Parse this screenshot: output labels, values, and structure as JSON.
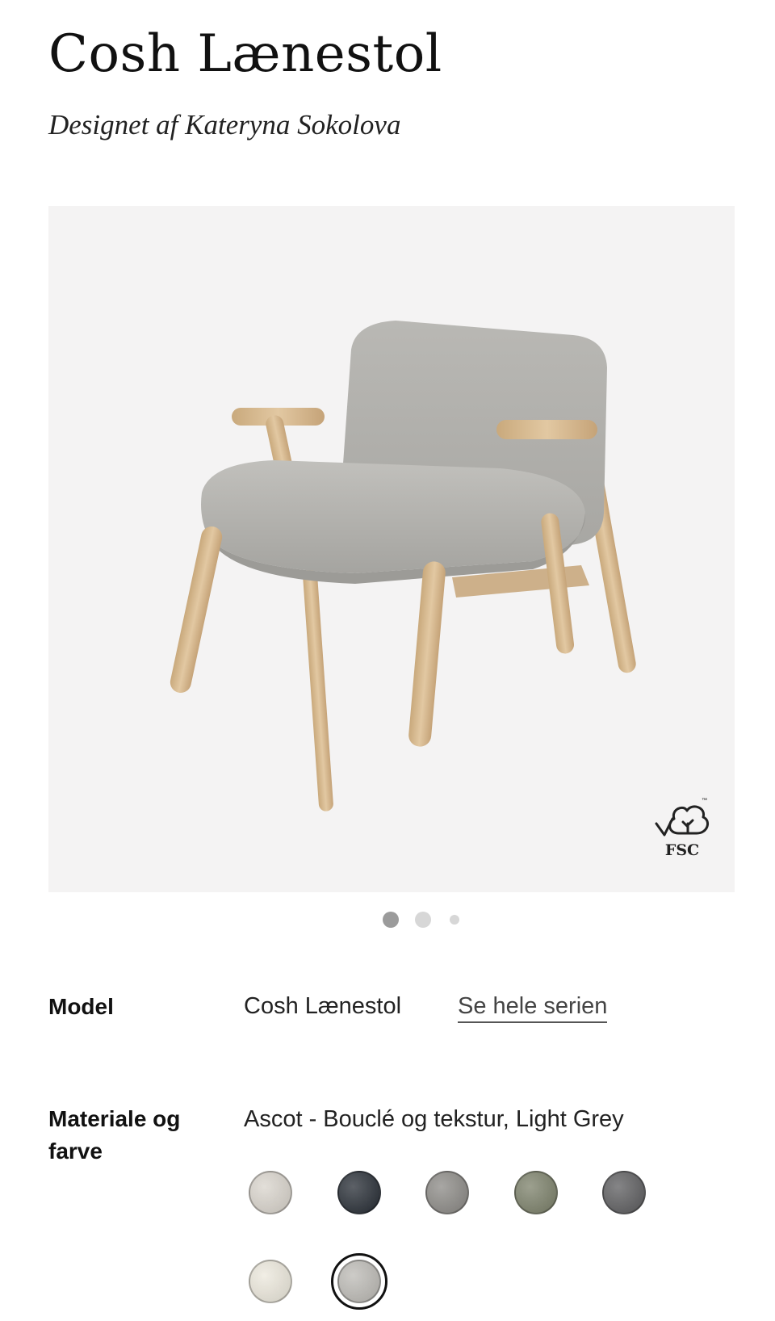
{
  "product": {
    "title": "Cosh Lænestol",
    "designer": "Designet af Kateryna Sokolova"
  },
  "gallery": {
    "image_icon": "armchair-product-photo",
    "badge_text": "FSC",
    "badge_tm": "™",
    "slides_count": 3,
    "active_slide": 1
  },
  "specs": {
    "model_label": "Model",
    "model_value": "Cosh Lænestol",
    "series_link": "Se hele serien",
    "material_label": "Materiale og farve",
    "material_value": "Ascot - Bouclé og tekstur, Light Grey"
  },
  "swatches": [
    {
      "name": "beige-boucle",
      "color": "#d9d4cc",
      "selected": false
    },
    {
      "name": "dark-navy",
      "color": "#262c34",
      "selected": false
    },
    {
      "name": "grey-brown",
      "color": "#8b8985",
      "selected": false
    },
    {
      "name": "olive-green",
      "color": "#7b8069",
      "selected": false
    },
    {
      "name": "charcoal",
      "color": "#5c5c5e",
      "selected": false
    },
    {
      "name": "cream",
      "color": "#ece8dc",
      "selected": false
    },
    {
      "name": "light-grey",
      "color": "#bcbab5",
      "selected": true
    }
  ],
  "colors": {
    "fabric": "#b3b2ae",
    "wood": "#d5b991",
    "gallery_bg": "#f4f3f3"
  }
}
